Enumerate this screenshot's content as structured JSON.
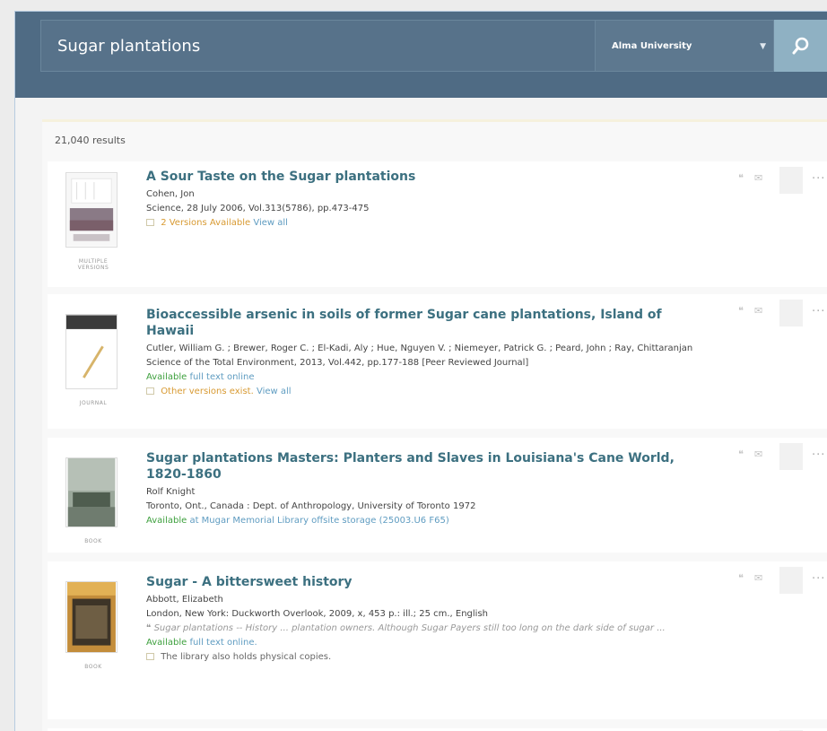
{
  "search": {
    "query": "Sugar plantations",
    "scope": "Alma University"
  },
  "results": {
    "count_label": "21,040 results",
    "items": [
      {
        "title": "A Sour Taste on the Sugar plantations",
        "author": "Cohen, Jon",
        "source": "Science, 28 July 2006, Vol.313(5786), pp.473-475",
        "versions_text": "2 Versions Available",
        "view_all": "View all",
        "type_label": "MULTIPLE VERSIONS"
      },
      {
        "title": "Bioaccessible arsenic in soils of former Sugar cane plantations, Island of Hawaii",
        "author": "Cutler, William G. ; Brewer, Roger C. ; El-Kadi, Aly ; Hue, Nguyen V. ; Niemeyer, Patrick G. ; Peard, John ; Ray, Chittaranjan",
        "source": "Science of the Total Environment, 2013, Vol.442, pp.177-188 [Peer Reviewed Journal]",
        "availability_label": "Available",
        "availability_text": "full text online",
        "versions_text": "Other versions exist.",
        "view_all": "View all",
        "type_label": "JOURNAL"
      },
      {
        "title": "Sugar plantations Masters: Planters and Slaves in Louisiana's Cane World, 1820-1860",
        "author": "Rolf Knight",
        "source": "Toronto, Ont., Canada : Dept. of Anthropology, University of Toronto 1972",
        "availability_label": "Available",
        "availability_text": "at Mugar Memorial Library offsite storage (25003.U6 F65)",
        "type_label": "BOOK"
      },
      {
        "title": "Sugar - A bittersweet history",
        "author": "Abbott, Elizabeth",
        "source": "London, New York: Duckworth Overlook, 2009, x, 453 p.: ill.; 25 cm., English",
        "snippet": "Sugar plantations -- History ... plantation owners. Although Sugar Payers still too long on the dark side of sugar ...",
        "availability_label": "Available",
        "availability_text": "full text online.",
        "physical_text": "The library also holds physical copies.",
        "type_label": "BOOK"
      }
    ]
  },
  "icons": {
    "search": "search-icon",
    "citation": "quote-icon",
    "email": "envelope-icon",
    "pin": "pin-icon",
    "more": "ellipsis-icon",
    "versions": "versions-icon"
  },
  "colors": {
    "header": "#4f6b84",
    "title": "#3c7080",
    "available": "#3ea03e",
    "link": "#5f9cc1",
    "versions": "#d89a32"
  }
}
